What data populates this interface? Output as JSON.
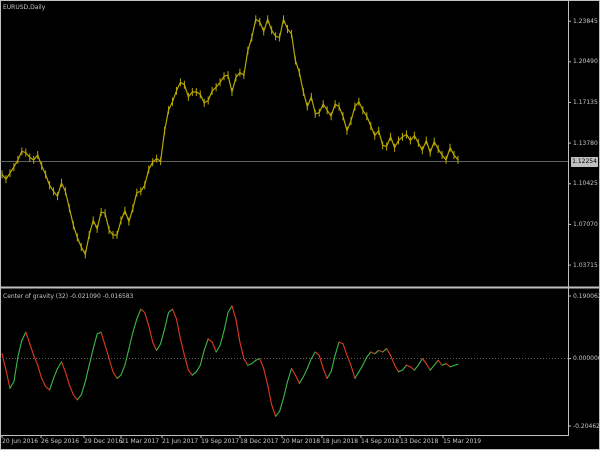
{
  "colors": {
    "background": "#000000",
    "frame": "#c0c0c0",
    "price": "#b8a800",
    "indicator_up": "#3cb84a",
    "indicator_down": "#e03a1e",
    "level_line": "#808080"
  },
  "main_chart": {
    "label": "EURUSD,Daily",
    "current_price": "1.12254"
  },
  "indicator": {
    "label": "Center of gravity (32) -0.021090 -0.016583"
  },
  "chart_data": [
    {
      "type": "line",
      "title": "EURUSD,Daily",
      "y_ticks": [
        "1.23845",
        "1.20490",
        "1.17135",
        "1.13780",
        "1.10425",
        "1.07070",
        "1.03715"
      ],
      "ylim": [
        1.024,
        1.251
      ],
      "x_ticks": [
        "20 Jun 2016",
        "26 Sep 2016",
        "29 Dec 2016",
        "21 Mar 2017",
        "21 Jun 2017",
        "19 Sep 2017",
        "18 Dec 2017",
        "20 Mar 2018",
        "18 Jun 2018",
        "14 Sep 2018",
        "13 Dec 2018",
        "15 Mar 2019"
      ],
      "current_level": 1.12254,
      "series": [
        {
          "x": [
            0,
            4,
            8,
            12,
            16,
            20,
            24,
            28,
            32,
            36,
            40,
            44,
            48,
            52,
            56,
            60,
            64,
            68,
            72,
            76,
            80,
            84,
            88,
            92,
            96,
            100,
            104,
            108,
            112,
            116,
            120,
            124,
            128,
            132,
            136,
            140,
            144,
            148,
            152,
            156,
            160,
            164,
            168,
            172,
            176,
            180,
            184,
            188,
            192,
            196,
            200,
            204,
            208,
            212,
            216,
            220,
            224,
            228,
            232,
            236,
            240,
            244,
            248,
            252,
            256,
            260,
            264,
            268,
            272,
            276,
            280,
            284,
            288,
            292,
            296,
            300,
            304,
            308,
            312,
            316,
            320,
            324,
            328,
            332,
            336,
            340,
            344,
            348,
            352,
            356,
            360,
            364,
            368,
            372,
            376,
            380,
            384,
            388,
            392,
            396,
            400,
            404,
            408,
            412,
            416,
            420,
            424,
            428,
            432,
            436,
            440,
            444,
            448,
            452,
            456,
            460
          ],
          "values": [
            1.112,
            1.108,
            1.113,
            1.118,
            1.124,
            1.131,
            1.13,
            1.126,
            1.124,
            1.128,
            1.119,
            1.112,
            1.103,
            1.098,
            1.094,
            1.105,
            1.098,
            1.084,
            1.07,
            1.06,
            1.052,
            1.046,
            1.062,
            1.074,
            1.067,
            1.081,
            1.08,
            1.066,
            1.062,
            1.062,
            1.074,
            1.082,
            1.073,
            1.084,
            1.097,
            1.098,
            1.103,
            1.116,
            1.122,
            1.125,
            1.123,
            1.148,
            1.165,
            1.172,
            1.181,
            1.188,
            1.186,
            1.176,
            1.18,
            1.18,
            1.178,
            1.171,
            1.173,
            1.181,
            1.184,
            1.188,
            1.193,
            1.194,
            1.18,
            1.192,
            1.196,
            1.194,
            1.214,
            1.225,
            1.24,
            1.238,
            1.23,
            1.24,
            1.231,
            1.226,
            1.225,
            1.24,
            1.232,
            1.228,
            1.206,
            1.196,
            1.18,
            1.168,
            1.176,
            1.162,
            1.163,
            1.17,
            1.165,
            1.16,
            1.17,
            1.168,
            1.16,
            1.148,
            1.156,
            1.168,
            1.172,
            1.165,
            1.16,
            1.152,
            1.144,
            1.148,
            1.136,
            1.135,
            1.143,
            1.134,
            1.14,
            1.143,
            1.145,
            1.14,
            1.144,
            1.138,
            1.132,
            1.14,
            1.13,
            1.139,
            1.133,
            1.128,
            1.124,
            1.134,
            1.128,
            1.124
          ]
        }
      ]
    },
    {
      "type": "line",
      "title": "Center of gravity (32) -0.021090 -0.016583",
      "y_ticks": [
        "0.190062",
        "0.000000",
        "-0.204625"
      ],
      "ylim": [
        -0.2046,
        0.1901
      ],
      "level": 0,
      "series": [
        {
          "x": [
            0,
            4,
            8,
            12,
            16,
            20,
            24,
            28,
            32,
            36,
            40,
            44,
            48,
            52,
            56,
            60,
            64,
            68,
            72,
            76,
            80,
            84,
            88,
            92,
            96,
            100,
            104,
            108,
            112,
            116,
            120,
            124,
            128,
            132,
            136,
            140,
            144,
            148,
            152,
            156,
            160,
            164,
            168,
            172,
            176,
            180,
            184,
            188,
            192,
            196,
            200,
            204,
            208,
            212,
            216,
            220,
            224,
            228,
            232,
            236,
            240,
            244,
            248,
            252,
            256,
            260,
            264,
            268,
            272,
            276,
            280,
            284,
            288,
            292,
            296,
            300,
            304,
            308,
            312,
            316,
            320,
            324,
            328,
            332,
            336,
            340,
            344,
            348,
            352,
            356,
            360,
            364,
            368,
            372,
            376,
            380,
            384,
            388,
            392,
            396,
            400,
            404,
            408,
            412,
            416,
            420,
            424,
            428,
            432,
            436,
            440,
            444,
            448,
            452,
            456,
            460
          ],
          "values": [
            0.015,
            -0.035,
            -0.09,
            -0.07,
            0.005,
            0.055,
            0.08,
            0.045,
            0.01,
            -0.02,
            -0.06,
            -0.085,
            -0.095,
            -0.06,
            -0.03,
            -0.01,
            -0.04,
            -0.08,
            -0.11,
            -0.125,
            -0.11,
            -0.07,
            -0.02,
            0.03,
            0.075,
            0.08,
            0.04,
            0.0,
            -0.04,
            -0.06,
            -0.05,
            -0.02,
            0.03,
            0.08,
            0.12,
            0.15,
            0.14,
            0.1,
            0.05,
            0.025,
            0.045,
            0.09,
            0.14,
            0.15,
            0.12,
            0.06,
            0.01,
            -0.035,
            -0.05,
            -0.04,
            -0.02,
            0.025,
            0.06,
            0.05,
            0.02,
            0.04,
            0.085,
            0.14,
            0.16,
            0.12,
            0.05,
            0.0,
            -0.02,
            -0.015,
            -0.005,
            0.0,
            -0.03,
            -0.08,
            -0.14,
            -0.175,
            -0.16,
            -0.12,
            -0.07,
            -0.03,
            -0.05,
            -0.075,
            -0.055,
            -0.03,
            0.0,
            0.02,
            0.01,
            -0.03,
            -0.06,
            -0.04,
            0.01,
            0.05,
            0.045,
            0.01,
            -0.02,
            -0.06,
            -0.04,
            -0.02,
            0.005,
            0.02,
            0.015,
            0.025,
            0.02,
            0.03,
            0.01,
            -0.02,
            -0.04,
            -0.035,
            -0.02,
            -0.025,
            -0.035,
            -0.02,
            0.0,
            -0.015,
            -0.035,
            -0.02,
            -0.005,
            -0.02,
            -0.015,
            -0.025,
            -0.021,
            -0.017
          ]
        }
      ]
    }
  ]
}
